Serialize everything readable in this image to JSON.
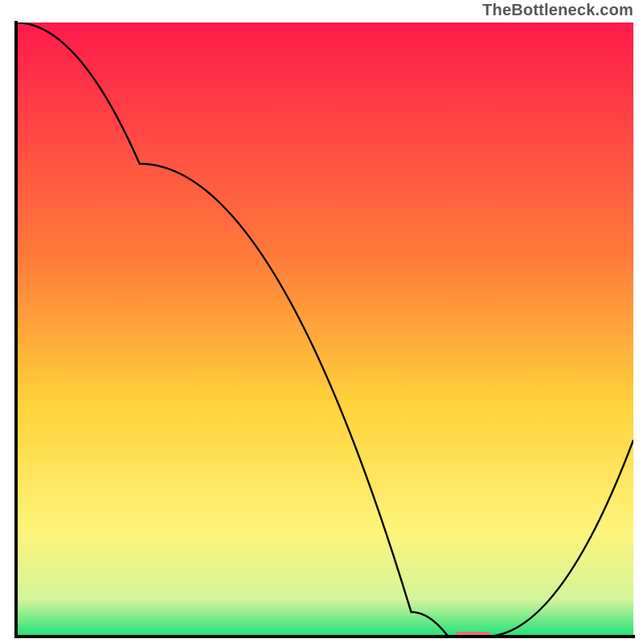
{
  "attribution": "TheBottleneck.com",
  "colors": {
    "frame_border": "#000000",
    "curve": "#000000",
    "marker_fill": "#e0736e",
    "gradient_top": "#ff1a4b",
    "gradient_mid1": "#ff7a3a",
    "gradient_mid2": "#ffd23a",
    "gradient_mid3": "#fff47a",
    "gradient_mid4": "#d2f59a",
    "gradient_bottom": "#1fe07a"
  },
  "chart_data": {
    "type": "line",
    "title": "",
    "xlabel": "",
    "ylabel": "",
    "xlim": [
      0,
      100
    ],
    "ylim": [
      0,
      100
    ],
    "curve": [
      {
        "x": 0,
        "y": 100
      },
      {
        "x": 20,
        "y": 77
      },
      {
        "x": 64,
        "y": 4
      },
      {
        "x": 70,
        "y": 0
      },
      {
        "x": 76,
        "y": 0
      },
      {
        "x": 100,
        "y": 32
      }
    ],
    "marker": {
      "x_start": 71,
      "x_end": 77,
      "y": 0
    },
    "grid": false,
    "legend": false
  }
}
